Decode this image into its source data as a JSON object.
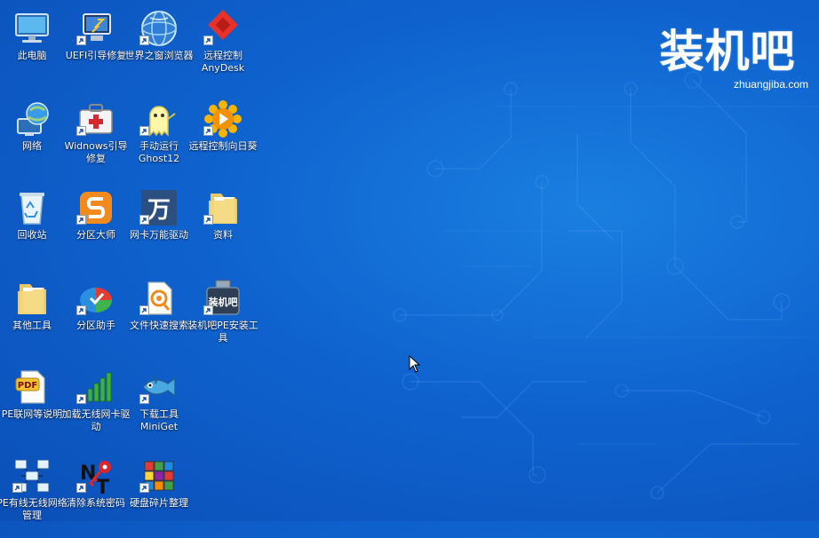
{
  "brand": {
    "logo_text": "装机吧",
    "logo_url_text": "zhuangjiba.com"
  },
  "colors": {
    "desktop_blue": "#0f63cf",
    "text": "#ffffff"
  },
  "icons": [
    {
      "label": "此电脑",
      "icon": "computer-icon"
    },
    {
      "label": "UEFI引导修复",
      "icon": "uefi-repair-icon",
      "shortcut": true
    },
    {
      "label": "世界之窗浏览器",
      "icon": "browser-globe-icon",
      "shortcut": true
    },
    {
      "label": "远程控制\nAnyDesk",
      "icon": "anydesk-icon",
      "shortcut": true
    },
    {
      "label": "网络",
      "icon": "network-globe-icon"
    },
    {
      "label": "Widnows引导修复",
      "icon": "first-aid-kit-icon",
      "shortcut": true
    },
    {
      "label": "手动运行\nGhost12",
      "icon": "ghost-icon",
      "shortcut": true
    },
    {
      "label": "远程控制向日葵",
      "icon": "sunflower-icon",
      "shortcut": true
    },
    {
      "label": "回收站",
      "icon": "recycle-bin-icon"
    },
    {
      "label": "分区大师",
      "icon": "partition-master-icon",
      "shortcut": true
    },
    {
      "label": "网卡万能驱动",
      "icon": "wan-driver-icon",
      "shortcut": true
    },
    {
      "label": "资料",
      "icon": "folder-icon",
      "shortcut": true
    },
    {
      "label": "其他工具",
      "icon": "folder-icon"
    },
    {
      "label": "分区助手",
      "icon": "partition-assistant-icon",
      "shortcut": true
    },
    {
      "label": "文件快速搜索",
      "icon": "file-search-icon",
      "shortcut": true
    },
    {
      "label": "装机吧PE安装工具",
      "icon": "usb-installer-icon",
      "shortcut": true
    },
    {
      "label": "PE联网等说明",
      "icon": "pdf-icon"
    },
    {
      "label": "加载无线网卡驱动",
      "icon": "wifi-signal-icon",
      "shortcut": true
    },
    {
      "label": "下载工具\nMiniGet",
      "icon": "fish-icon",
      "shortcut": true
    },
    {
      "label": "PE有线无线网络管理",
      "icon": "network-manager-icon",
      "shortcut": true
    },
    {
      "label": "清除系统密码",
      "icon": "nt-password-icon",
      "shortcut": true
    },
    {
      "label": "硬盘碎片整理",
      "icon": "defrag-icon",
      "shortcut": true
    }
  ]
}
